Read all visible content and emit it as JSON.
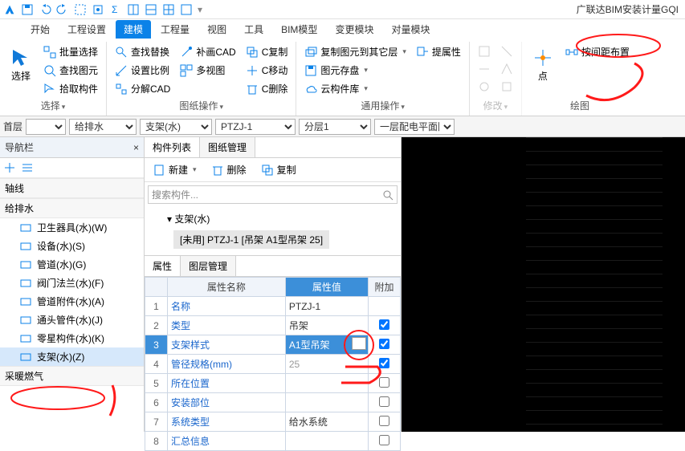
{
  "app": {
    "title": "广联达BIM安装计量GQI"
  },
  "tabs": [
    "开始",
    "工程设置",
    "建模",
    "工程量",
    "视图",
    "工具",
    "BIM模型",
    "变更模块",
    "对量模块"
  ],
  "activeTab": 2,
  "ribbon": {
    "select": {
      "label": "选择",
      "big": "选择",
      "batch": "批量选择",
      "find": "查找图元",
      "pick": "拾取构件"
    },
    "paper": {
      "label": "图纸操作",
      "findReplace": "查找替换",
      "setScale": "设置比例",
      "decompose": "分解CAD",
      "supplement": "补画CAD",
      "multiView": "多视图",
      "copy": "C复制",
      "move": "C移动",
      "del": "C删除"
    },
    "general": {
      "label": "通用操作",
      "copyLayer": "复制图元到其它层",
      "saveView": "图元存盘",
      "cloud": "云构件库",
      "extract": "提属性"
    },
    "modify": {
      "label": "修改"
    },
    "draw": {
      "label": "绘图",
      "point": "点",
      "byDist": "按间距布置"
    }
  },
  "filters": {
    "floor": "首层",
    "sys": "给排水",
    "comp": "支架(水)",
    "type": "PTZJ-1",
    "layer": "分层1",
    "plan": "一层配电平面图"
  },
  "nav": {
    "title": "导航栏",
    "sections": [
      "轴线",
      "给排水",
      "采暖燃气"
    ],
    "items": [
      {
        "label": "卫生器具(水)(W)"
      },
      {
        "label": "设备(水)(S)"
      },
      {
        "label": "管道(水)(G)"
      },
      {
        "label": "阀门法兰(水)(F)"
      },
      {
        "label": "管道附件(水)(A)"
      },
      {
        "label": "通头管件(水)(J)"
      },
      {
        "label": "零星构件(水)(K)"
      },
      {
        "label": "支架(水)(Z)",
        "selected": true
      }
    ]
  },
  "compList": {
    "tabs": [
      "构件列表",
      "图纸管理"
    ],
    "toolbar": {
      "new": "新建",
      "del": "删除",
      "copy": "复制"
    },
    "searchPlaceholder": "搜索构件...",
    "root": "支架(水)",
    "leaf": "[未用] PTZJ-1 [吊架 A1型吊架 25]"
  },
  "props": {
    "tabs": [
      "属性",
      "图层管理"
    ],
    "headers": {
      "name": "属性名称",
      "value": "属性值",
      "extra": "附加"
    },
    "rows": [
      {
        "idx": "1",
        "name": "名称",
        "value": "PTZJ-1",
        "chk": null
      },
      {
        "idx": "2",
        "name": "类型",
        "value": "吊架",
        "chk": true
      },
      {
        "idx": "3",
        "name": "支架样式",
        "value": "A1型吊架",
        "chk": true,
        "editing": true
      },
      {
        "idx": "4",
        "name": "管径规格(mm)",
        "value": "25",
        "chk": true,
        "gray": true
      },
      {
        "idx": "5",
        "name": "所在位置",
        "value": "",
        "chk": false
      },
      {
        "idx": "6",
        "name": "安装部位",
        "value": "",
        "chk": false
      },
      {
        "idx": "7",
        "name": "系统类型",
        "value": "给水系统",
        "chk": false
      },
      {
        "idx": "8",
        "name": "汇总信息",
        "value": "",
        "chk": false
      }
    ]
  }
}
